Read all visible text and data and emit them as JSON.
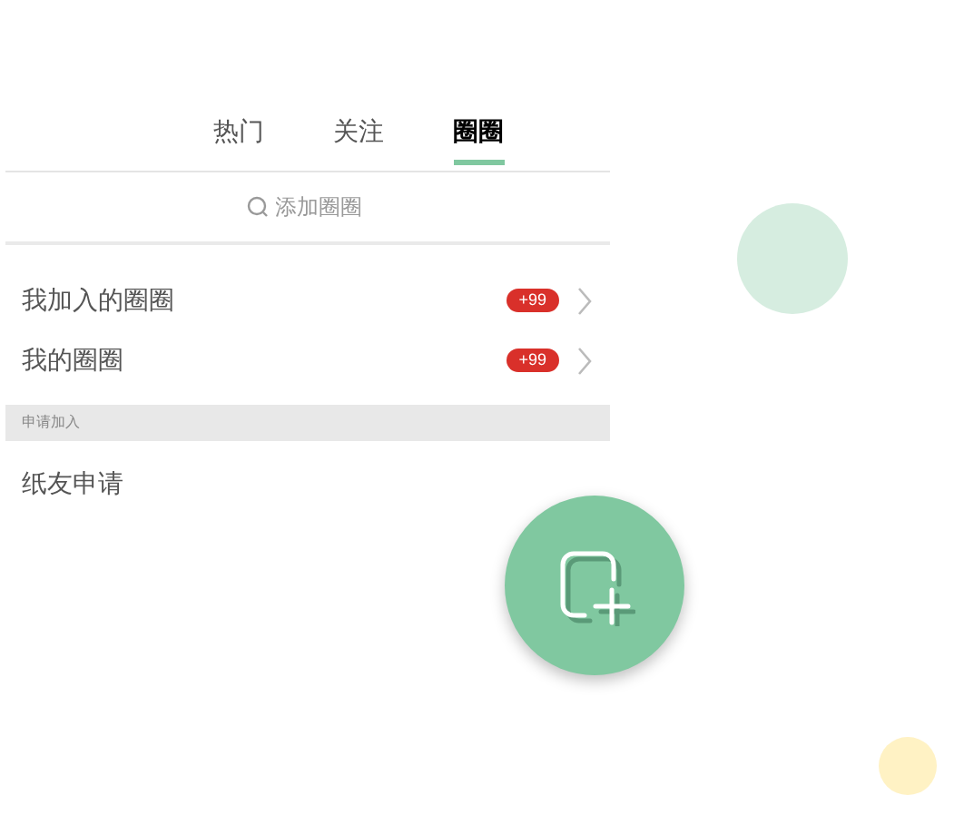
{
  "tabs": [
    {
      "label": "热门",
      "selected": false
    },
    {
      "label": "关注",
      "selected": false
    },
    {
      "label": "圈圈",
      "selected": true
    }
  ],
  "search": {
    "placeholder": "添加圈圈"
  },
  "rows": [
    {
      "label": "我加入的圈圈",
      "badge": "+99"
    },
    {
      "label": "我的圈圈",
      "badge": "+99"
    }
  ],
  "section": {
    "header": "申请加入",
    "rows": [
      {
        "label": "纸友申请"
      }
    ]
  }
}
